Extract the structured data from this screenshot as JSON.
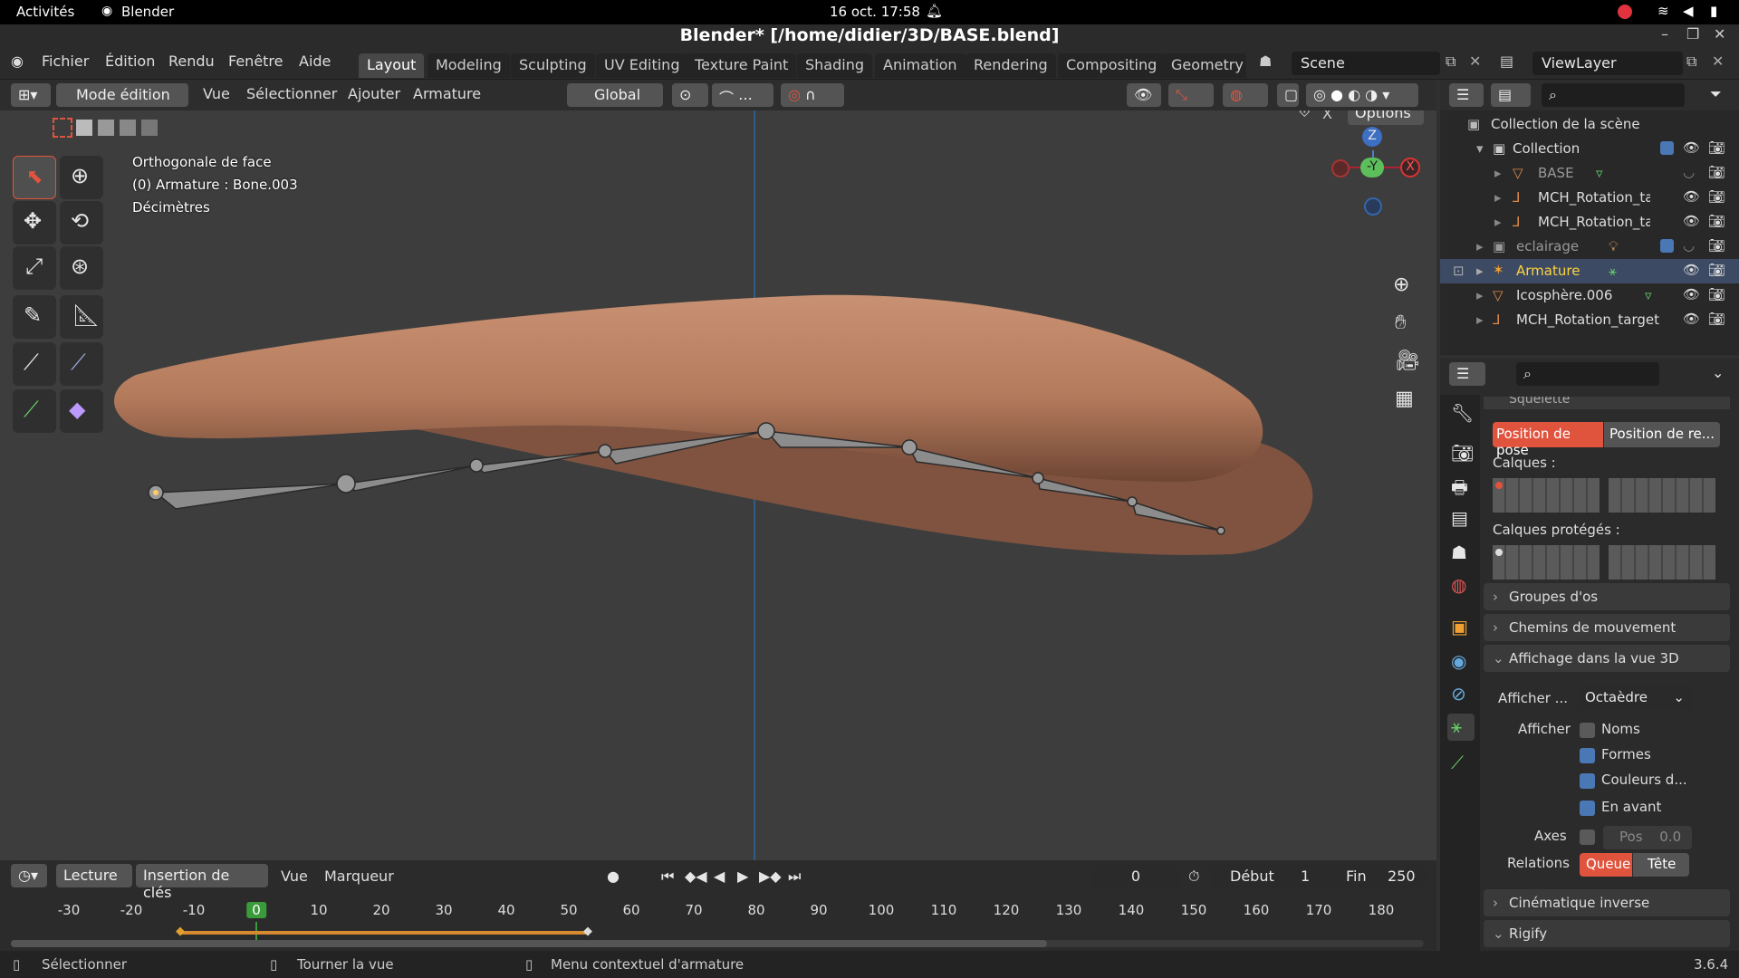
{
  "gnome": {
    "activities": "Activités",
    "app": "Blender",
    "datetime": "16 oct.  17:58"
  },
  "window": {
    "title": "Blender* [/home/didier/3D/BASE.blend]"
  },
  "menu": [
    "Fichier",
    "Édition",
    "Rendu",
    "Fenêtre",
    "Aide"
  ],
  "workspaces": [
    "Layout",
    "Modeling",
    "Sculpting",
    "UV Editing",
    "Texture Paint",
    "Shading",
    "Animation",
    "Rendering",
    "Compositing",
    "Geometry N"
  ],
  "scene": {
    "label": "Scene",
    "viewlayer": "ViewLayer"
  },
  "viewport_header": {
    "mode": "Mode édition",
    "vue": "Vue",
    "select": "Sélectionner",
    "add": "Ajouter",
    "armature": "Armature",
    "orientation": "Global",
    "options": "Options"
  },
  "overlay": {
    "line1": "Orthogonale de face",
    "line2": "(0) Armature : Bone.003",
    "line3": "Décimètres"
  },
  "gizmo": {
    "z": "Z",
    "y": "-Y",
    "x": "X"
  },
  "outliner": {
    "root": "Collection de la scène",
    "rows": [
      {
        "name": "Collection"
      },
      {
        "name": "BASE"
      },
      {
        "name": "MCH_Rotation_ta"
      },
      {
        "name": "MCH_Rotation_ta"
      },
      {
        "name": "eclairage"
      },
      {
        "name": "Armature"
      },
      {
        "name": "Icosphère.006"
      },
      {
        "name": "MCH_Rotation_target"
      }
    ]
  },
  "properties": {
    "section_top": "Squelette",
    "pose_btn": "Position de pose",
    "rest_btn": "Position de re...",
    "layers": "Calques :",
    "protected": "Calques protégés :",
    "panels": [
      "Groupes d'os",
      "Chemins de mouvement",
      "Affichage dans la vue 3D",
      "Cinématique inverse",
      "Rigify"
    ],
    "display_as_label": "Afficher ...",
    "display_as_value": "Octaèdre",
    "show_label": "Afficher",
    "names": "Noms",
    "shapes": "Formes",
    "colors": "Couleurs d...",
    "infront": "En avant",
    "axes": "Axes",
    "pos": "Pos",
    "pos_val": "0.0",
    "relations": "Relations",
    "queue": "Queue",
    "tete": "Tête"
  },
  "timeline": {
    "playback": "Lecture",
    "keying": "Insertion de clés",
    "vue": "Vue",
    "marker": "Marqueur",
    "frame": "0",
    "start_label": "Début",
    "start": "1",
    "end_label": "Fin",
    "end": "250",
    "ticks": [
      "-30",
      "-20",
      "-10",
      "0",
      "10",
      "20",
      "30",
      "40",
      "50",
      "60",
      "70",
      "80",
      "90",
      "100",
      "110",
      "120",
      "130",
      "140",
      "150",
      "160",
      "170",
      "180"
    ]
  },
  "status": {
    "select": "Sélectionner",
    "rotate": "Tourner la vue",
    "context": "Menu contextuel d'armature",
    "version": "3.6.4"
  },
  "colors": {
    "accent": "#e0533d",
    "selected": "#4a78b5",
    "mesh": "#b87c5e"
  }
}
